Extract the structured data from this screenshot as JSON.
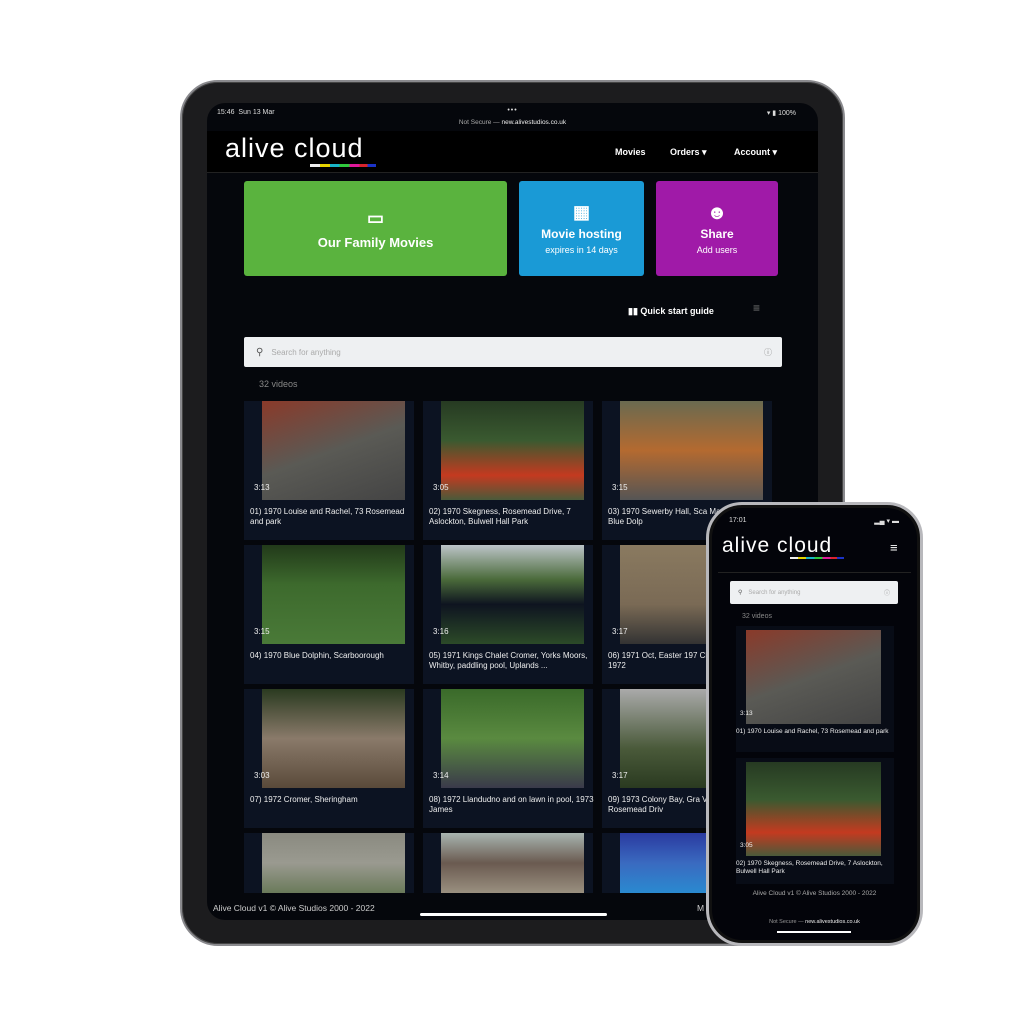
{
  "tablet": {
    "status": {
      "time": "15:46",
      "date": "Sun 13 Mar",
      "battery": "100%",
      "url_prefix": "Not Secure —",
      "url": "new.alivestudios.co.uk"
    },
    "logo": "alive cloud",
    "nav": [
      {
        "label": "Movies",
        "dropdown": false
      },
      {
        "label": "Orders",
        "dropdown": true
      },
      {
        "label": "Account",
        "dropdown": true
      }
    ],
    "tiles": [
      {
        "title": "Our Family Movies",
        "sub": "",
        "icon": "ticket-icon",
        "color": "#5ab33e"
      },
      {
        "title": "Movie hosting",
        "sub": "expires in 14 days",
        "icon": "calendar-icon",
        "color": "#1a9ad6"
      },
      {
        "title": "Share",
        "sub": "Add users",
        "icon": "smiley-icon",
        "color": "#a01aa8"
      }
    ],
    "quick_start": "Quick start guide",
    "search_placeholder": "Search for anything",
    "count": "32 videos",
    "videos": [
      {
        "title": "01) 1970 Louise and Rachel, 73 Rosemead and park",
        "duration": "3:13"
      },
      {
        "title": "02) 1970 Skegness, Rosemead Drive, 7 Aslockton, Bulwell Hall Park",
        "duration": "3:05"
      },
      {
        "title": "03) 1970 Sewerby Hall, Sca Martin at home, Blue Dolp",
        "duration": "3:15"
      },
      {
        "title": "04) 1970 Blue Dolphin, Scarboorough",
        "duration": "3:15"
      },
      {
        "title": "05) 1971 Kings Chalet Cromer, Yorks Moors, Whitby, paddling pool, Uplands ...",
        "duration": "3:16"
      },
      {
        "title": "06) 1971 Oct, Easter 197 Christening, June 1972",
        "duration": "3:17"
      },
      {
        "title": "07) 1972 Cromer, Sheringham",
        "duration": "3:03"
      },
      {
        "title": "08) 1972 Llandudno and on lawn in pool, 1973 James",
        "duration": "3:14"
      },
      {
        "title": "09) 1973 Colony Bay, Gra Virile, 73 Rosemead Driv",
        "duration": "3:17"
      },
      {
        "title": "",
        "duration": ""
      },
      {
        "title": "",
        "duration": ""
      },
      {
        "title": "",
        "duration": ""
      }
    ],
    "footer": "Alive Cloud v1 © Alive Studios 2000 - 2022",
    "footer_right": "M"
  },
  "phone": {
    "status": {
      "time": "17:01"
    },
    "logo": "alive cloud",
    "search_placeholder": "Search for anything",
    "count": "32 videos",
    "videos": [
      {
        "title": "01) 1970 Louise and Rachel, 73 Rosemead and park",
        "duration": "3:13"
      },
      {
        "title": "02) 1970 Skegness, Rosemead Drive, 7 Aslockton, Bulwell Hall Park",
        "duration": "3:05"
      }
    ],
    "footer": "Alive Cloud v1 © Alive Studios 2000 - 2022",
    "url_prefix": "Not Secure —",
    "url": "new.alivestudios.co.uk"
  }
}
